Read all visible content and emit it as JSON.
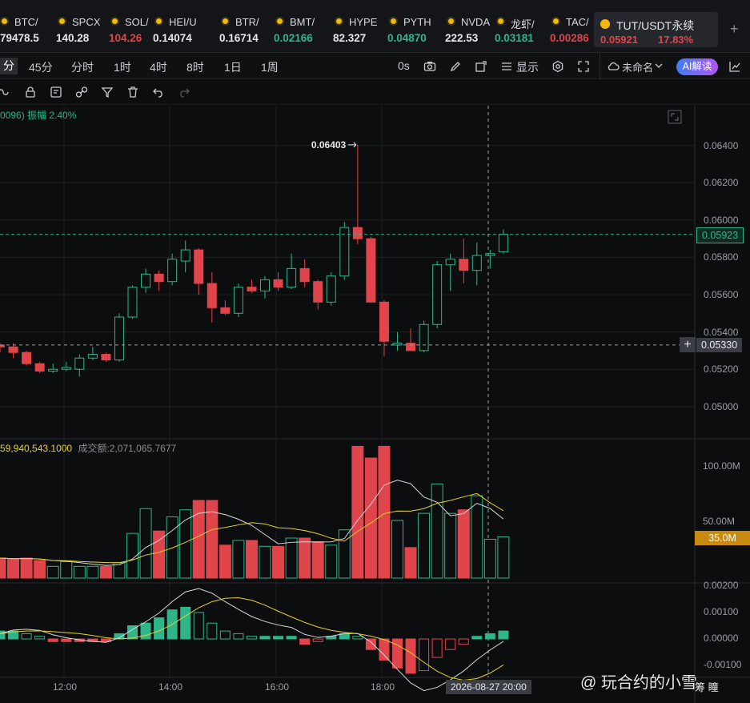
{
  "ticker": [
    {
      "sym": "BTC/",
      "price": "79478.5",
      "color": "white"
    },
    {
      "sym": "SPCX",
      "price": "140.28",
      "color": "white"
    },
    {
      "sym": "SOL/",
      "price": "104.26",
      "color": "red"
    },
    {
      "sym": "HEI/U",
      "price": "0.14074",
      "color": "white"
    },
    {
      "sym": "BTR/",
      "price": "0.16714",
      "color": "white"
    },
    {
      "sym": "BMT/",
      "price": "0.02166",
      "color": "green"
    },
    {
      "sym": "HYPE",
      "price": "82.327",
      "color": "white"
    },
    {
      "sym": "PYTH",
      "price": "0.04870",
      "color": "green"
    },
    {
      "sym": "NVDA",
      "price": "222.53",
      "color": "white"
    },
    {
      "sym": "龙虾/",
      "price": "0.03181",
      "color": "green"
    },
    {
      "sym": "TAC/",
      "price": "0.00286",
      "color": "red"
    }
  ],
  "active": {
    "sym": "TUT/USDT永续",
    "price": "0.05921",
    "change": "17.83%"
  },
  "add_tab": "+",
  "periods": [
    "分",
    "45分",
    "分时",
    "1时",
    "4时",
    "8时",
    "1日",
    "1周"
  ],
  "toolbar": {
    "countdown": "0s",
    "display": "显示",
    "layout_name": "未命名",
    "ai": "AI解读"
  },
  "legend": {
    "main": "0096) 振幅 2.40%",
    "vol_value": "59,940,543.1000",
    "vol_amount_label": "成交额:2,071,065.7677"
  },
  "price_axis": [
    "0.06400",
    "0.06200",
    "0.06000",
    "0.05800",
    "0.05600",
    "0.05400",
    "0.05200",
    "0.05000"
  ],
  "price_tags": {
    "current": "0.05923",
    "crosshair": "0.05330",
    "high_label": "0.06403"
  },
  "vol_axis": [
    "100.00M",
    "50.00M"
  ],
  "vol_tag": "35.0M",
  "macd_axis": [
    "0.00200",
    "0.00100",
    "0.00000",
    "-0.00100"
  ],
  "time_axis": [
    "12:00",
    "14:00",
    "16:00",
    "18:00"
  ],
  "crosshair_time": "2026-08-27 20:00",
  "watermark": "@ 玩合约的小雪",
  "watermark_sub": "筹 瞳",
  "colors": {
    "up": "#2eb68a",
    "down": "#e0454b",
    "bg": "#0c0d0f",
    "grid": "#1e2024",
    "ma_white": "#d8d8d8",
    "ma_yellow": "#e6d22a"
  },
  "chart_data": {
    "type": "candlestick",
    "candles": [
      {
        "o": 0.0533,
        "h": 0.0534,
        "l": 0.0529,
        "c": 0.0532
      },
      {
        "o": 0.0532,
        "h": 0.0534,
        "l": 0.0526,
        "c": 0.0529
      },
      {
        "o": 0.0529,
        "h": 0.053,
        "l": 0.0522,
        "c": 0.0523
      },
      {
        "o": 0.0523,
        "h": 0.0524,
        "l": 0.0518,
        "c": 0.0519
      },
      {
        "o": 0.0519,
        "h": 0.0523,
        "l": 0.0518,
        "c": 0.052
      },
      {
        "o": 0.052,
        "h": 0.0524,
        "l": 0.0519,
        "c": 0.0521
      },
      {
        "o": 0.052,
        "h": 0.0528,
        "l": 0.0516,
        "c": 0.0526
      },
      {
        "o": 0.0526,
        "h": 0.0532,
        "l": 0.0525,
        "c": 0.0528
      },
      {
        "o": 0.0528,
        "h": 0.0529,
        "l": 0.0524,
        "c": 0.0525
      },
      {
        "o": 0.0525,
        "h": 0.055,
        "l": 0.0524,
        "c": 0.0548
      },
      {
        "o": 0.0548,
        "h": 0.0565,
        "l": 0.0547,
        "c": 0.0564
      },
      {
        "o": 0.0564,
        "h": 0.0574,
        "l": 0.0561,
        "c": 0.0571
      },
      {
        "o": 0.0571,
        "h": 0.0573,
        "l": 0.0562,
        "c": 0.0567
      },
      {
        "o": 0.0567,
        "h": 0.0582,
        "l": 0.0565,
        "c": 0.0579
      },
      {
        "o": 0.0578,
        "h": 0.0589,
        "l": 0.0572,
        "c": 0.0584
      },
      {
        "o": 0.0584,
        "h": 0.0585,
        "l": 0.056,
        "c": 0.0566
      },
      {
        "o": 0.0566,
        "h": 0.0572,
        "l": 0.0545,
        "c": 0.0553
      },
      {
        "o": 0.0553,
        "h": 0.0557,
        "l": 0.0549,
        "c": 0.055
      },
      {
        "o": 0.055,
        "h": 0.0566,
        "l": 0.0548,
        "c": 0.0564
      },
      {
        "o": 0.0564,
        "h": 0.0568,
        "l": 0.0561,
        "c": 0.0562
      },
      {
        "o": 0.0562,
        "h": 0.057,
        "l": 0.0558,
        "c": 0.0568
      },
      {
        "o": 0.0568,
        "h": 0.0572,
        "l": 0.0562,
        "c": 0.0564
      },
      {
        "o": 0.0564,
        "h": 0.0582,
        "l": 0.0563,
        "c": 0.0574
      },
      {
        "o": 0.0574,
        "h": 0.0579,
        "l": 0.0564,
        "c": 0.0567
      },
      {
        "o": 0.0567,
        "h": 0.0568,
        "l": 0.0552,
        "c": 0.0556
      },
      {
        "o": 0.0556,
        "h": 0.0572,
        "l": 0.0554,
        "c": 0.057
      },
      {
        "o": 0.057,
        "h": 0.0599,
        "l": 0.0568,
        "c": 0.0596
      },
      {
        "o": 0.0596,
        "h": 0.06403,
        "l": 0.0587,
        "c": 0.059
      },
      {
        "o": 0.059,
        "h": 0.0591,
        "l": 0.0556,
        "c": 0.0556
      },
      {
        "o": 0.0556,
        "h": 0.0557,
        "l": 0.0527,
        "c": 0.0535
      },
      {
        "o": 0.0533,
        "h": 0.054,
        "l": 0.053,
        "c": 0.0534
      },
      {
        "o": 0.0534,
        "h": 0.0542,
        "l": 0.0531,
        "c": 0.053
      },
      {
        "o": 0.053,
        "h": 0.0546,
        "l": 0.0529,
        "c": 0.0544
      },
      {
        "o": 0.0544,
        "h": 0.0578,
        "l": 0.0542,
        "c": 0.0576
      },
      {
        "o": 0.0576,
        "h": 0.0582,
        "l": 0.0562,
        "c": 0.0579
      },
      {
        "o": 0.0579,
        "h": 0.059,
        "l": 0.0566,
        "c": 0.0573
      },
      {
        "o": 0.0573,
        "h": 0.0588,
        "l": 0.0565,
        "c": 0.0581
      },
      {
        "o": 0.0581,
        "h": 0.0584,
        "l": 0.0574,
        "c": 0.0582
      },
      {
        "o": 0.0583,
        "h": 0.0595,
        "l": 0.0582,
        "c": 0.05923
      }
    ],
    "volume": [
      17,
      16,
      17,
      15,
      10,
      14,
      10,
      10,
      10,
      13,
      38,
      59,
      40,
      52,
      58,
      66,
      66,
      28,
      32,
      32,
      27,
      27,
      34,
      34,
      31,
      28,
      41,
      112,
      102,
      112,
      49,
      26,
      55,
      80,
      55,
      58,
      70,
      33,
      35
    ],
    "macd_hist": [
      0.0003,
      0.0003,
      0.0002,
      0.0001,
      -0.0001,
      -0.0001,
      -0.0001,
      -0.0001,
      -0.0001,
      0.0002,
      0.0005,
      0.0006,
      0.0008,
      0.0011,
      0.0012,
      0.001,
      0.0006,
      0.0003,
      0.0002,
      0.0001,
      0.0001,
      0.0001,
      0.0001,
      -0.0002,
      -0.0001,
      0.0001,
      0.0002,
      0.0001,
      -0.0004,
      -0.0008,
      -0.0011,
      -0.0013,
      -0.0012,
      -0.0007,
      -0.0004,
      -0.0002,
      0.0001,
      0.0002,
      0.0003
    ]
  }
}
